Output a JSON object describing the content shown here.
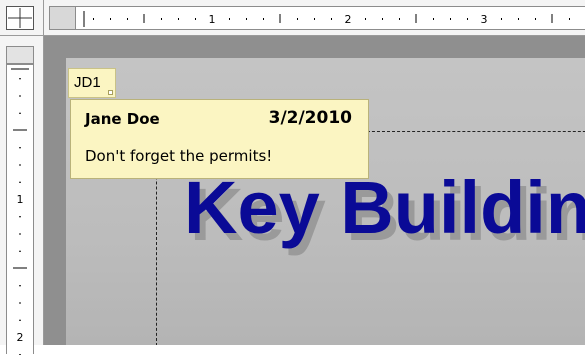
{
  "horizontal_ruler": {
    "labels": [
      "1",
      "2",
      "3"
    ]
  },
  "vertical_ruler": {
    "labels": [
      "1",
      "2"
    ]
  },
  "slide": {
    "title_text": "Key Buildin"
  },
  "comment": {
    "initials": "JD1",
    "author": "Jane Doe",
    "date": "3/2/2010",
    "text": "Don't forget the permits!"
  },
  "colors": {
    "title": "#0a0a96",
    "comment_background": "#fbf5c2",
    "workspace": "#8f8f8f"
  }
}
